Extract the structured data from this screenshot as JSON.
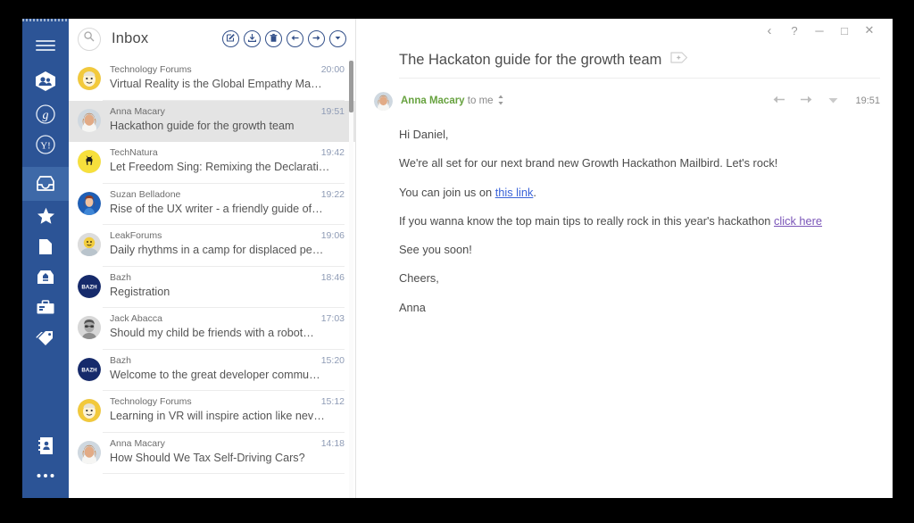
{
  "window": {
    "controls": [
      {
        "name": "back",
        "glyph": "‹"
      },
      {
        "name": "help",
        "glyph": "?"
      },
      {
        "name": "minimize",
        "glyph": "─"
      },
      {
        "name": "maximize",
        "glyph": "□"
      },
      {
        "name": "close",
        "glyph": "✕"
      }
    ]
  },
  "sidebar": {
    "accent_color": "#2c5496",
    "active_color": "#3e69a8",
    "items": [
      {
        "icon": "hamburger-menu-icon",
        "label": "Menu"
      },
      {
        "icon": "accounts-people-icon",
        "label": "Accounts"
      },
      {
        "icon": "google-account-icon",
        "label": "Google"
      },
      {
        "icon": "yahoo-account-icon",
        "label": "Yahoo"
      },
      {
        "icon": "inbox-icon",
        "label": "Inbox",
        "active": true
      },
      {
        "icon": "star-icon",
        "label": "Starred"
      },
      {
        "icon": "drafts-icon",
        "label": "Drafts"
      },
      {
        "icon": "archive-icon",
        "label": "Archive"
      },
      {
        "icon": "toolbox-icon",
        "label": "Apps"
      },
      {
        "icon": "tag-icon",
        "label": "Labels"
      }
    ],
    "bottom_items": [
      {
        "icon": "contacts-book-icon",
        "label": "Contacts"
      },
      {
        "icon": "more-options-icon",
        "label": "More"
      }
    ]
  },
  "list_toolbar": {
    "search_icon": "search-icon",
    "folder_name": "Inbox",
    "actions": [
      {
        "icon": "compose-icon",
        "label": "Compose"
      },
      {
        "icon": "archive-download-icon",
        "label": "Archive"
      },
      {
        "icon": "delete-trash-icon",
        "label": "Delete"
      },
      {
        "icon": "reply-icon",
        "label": "Reply"
      },
      {
        "icon": "forward-icon",
        "label": "Forward"
      },
      {
        "icon": "more-chevron-icon",
        "label": "More"
      }
    ]
  },
  "mail_list": {
    "messages": [
      {
        "sender": "Technology Forums",
        "subject": "Virtual Reality is the Global Empathy Ma…",
        "time": "20:00",
        "avatar": "tech-forums-face",
        "selected": false
      },
      {
        "sender": "Anna Macary",
        "subject": "Hackathon guide for the growth team",
        "time": "19:51",
        "avatar": "anna-photo",
        "selected": true
      },
      {
        "sender": "TechNatura",
        "subject": "Let Freedom Sing: Remixing the Declarati…",
        "time": "19:42",
        "avatar": "deer-yellow",
        "selected": false
      },
      {
        "sender": "Suzan Belladone",
        "subject": "Rise of the UX writer - a friendly guide of…",
        "time": "19:22",
        "avatar": "suzan-photo",
        "selected": false
      },
      {
        "sender": "LeakForums",
        "subject": "Daily rhythms in a camp for displaced pe…",
        "time": "19:06",
        "avatar": "leak-emoji",
        "selected": false
      },
      {
        "sender": "Bazh",
        "subject": "Registration",
        "time": "18:46",
        "avatar": "bazh-logo",
        "selected": false
      },
      {
        "sender": "Jack Abacca",
        "subject": "Should my child be friends with a robot…",
        "time": "17:03",
        "avatar": "jack-photo",
        "selected": false
      },
      {
        "sender": "Bazh",
        "subject": "Welcome to the great developer commu…",
        "time": "15:20",
        "avatar": "bazh-logo",
        "selected": false
      },
      {
        "sender": "Technology Forums",
        "subject": "Learning in VR will inspire action like nev…",
        "time": "15:12",
        "avatar": "tech-forums-face",
        "selected": false
      },
      {
        "sender": "Anna Macary",
        "subject": "How Should We Tax Self-Driving Cars?",
        "time": "14:18",
        "avatar": "anna-photo",
        "selected": false
      }
    ]
  },
  "reader": {
    "subject": "The Hackaton guide for the growth team",
    "add_tag_icon": "tag-plus-icon",
    "message": {
      "sender_name": "Anna Macary",
      "recipients": "to me",
      "expand_icon": "up-down-chevron-icon",
      "time": "19:51",
      "actions": [
        {
          "icon": "reply-arrow-icon",
          "label": "Reply"
        },
        {
          "icon": "forward-arrow-icon",
          "label": "Forward"
        },
        {
          "icon": "more-chevron-icon",
          "label": "More"
        }
      ],
      "body": {
        "greeting": "Hi Daniel,",
        "para1": "We're all set for our next brand new Growth Hackathon Mailbird. Let's rock!",
        "para2_before": "You can join us on ",
        "para2_link": "this link",
        "para2_after": ".",
        "para3_before": "If you wanna know the top main tips to really rock in this year's hackathon ",
        "para3_link": "click here",
        "para3_after": "",
        "para4": "See you soon!",
        "para5": "Cheers,",
        "para6": "Anna"
      },
      "link_color": "#3a63d8",
      "visited_link_color": "#7a55b8",
      "sender_color": "#67a23f"
    }
  }
}
